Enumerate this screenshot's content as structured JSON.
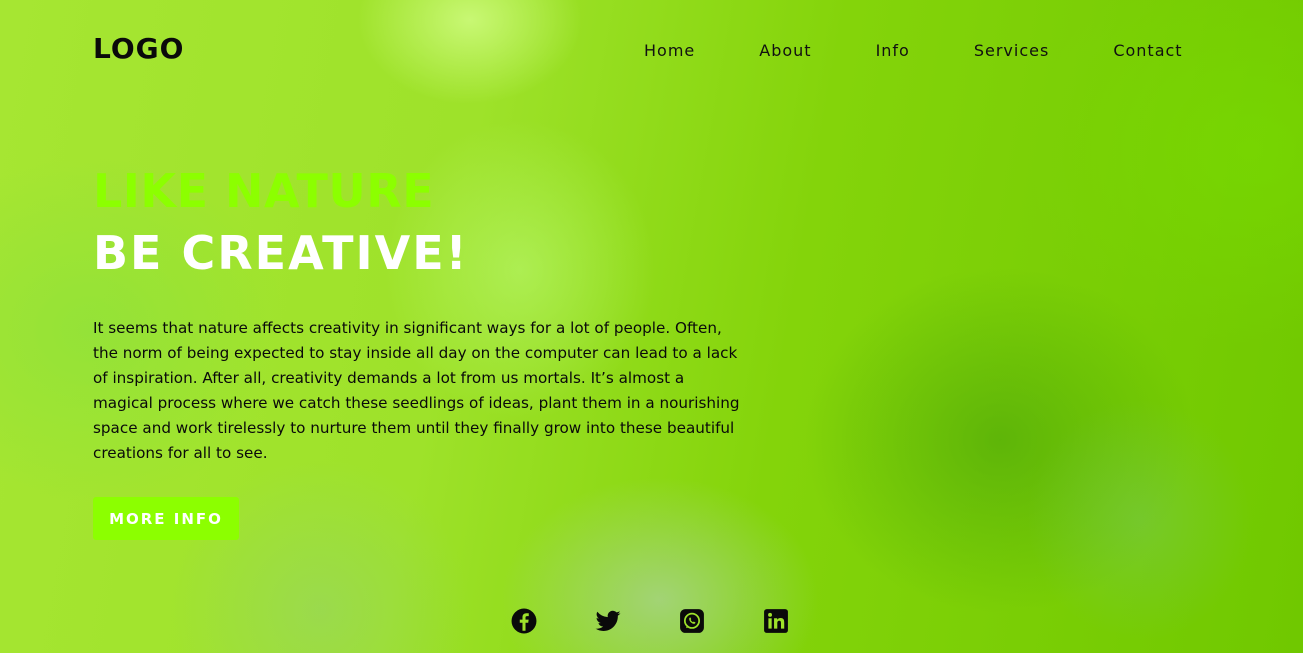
{
  "header": {
    "logo": "LOGO",
    "nav": [
      "Home",
      "About",
      "Info",
      "Services",
      "Contact"
    ]
  },
  "hero": {
    "headline_1": "LIKE NATURE",
    "headline_2": "BE CREATIVE!",
    "description": "It seems that nature affects creativity in significant ways for a lot of people. Often, the norm of being expected to stay inside all day on the computer can lead to a lack of inspiration. After all, creativity demands a lot from us mortals. It’s almost a magical process where we catch these seedlings of ideas, plant them in a nourishing space and work tirelessly to nurture them until they finally grow into these beautiful creations for all to see.",
    "button_label": "MORE INFO"
  },
  "socials": [
    "facebook-icon",
    "twitter-icon",
    "whatsapp-icon",
    "linkedin-icon"
  ],
  "colors": {
    "accent": "#8cff00",
    "text_dark": "#0a0a0a",
    "text_light": "#ffffff",
    "background": "#7ed20a"
  }
}
